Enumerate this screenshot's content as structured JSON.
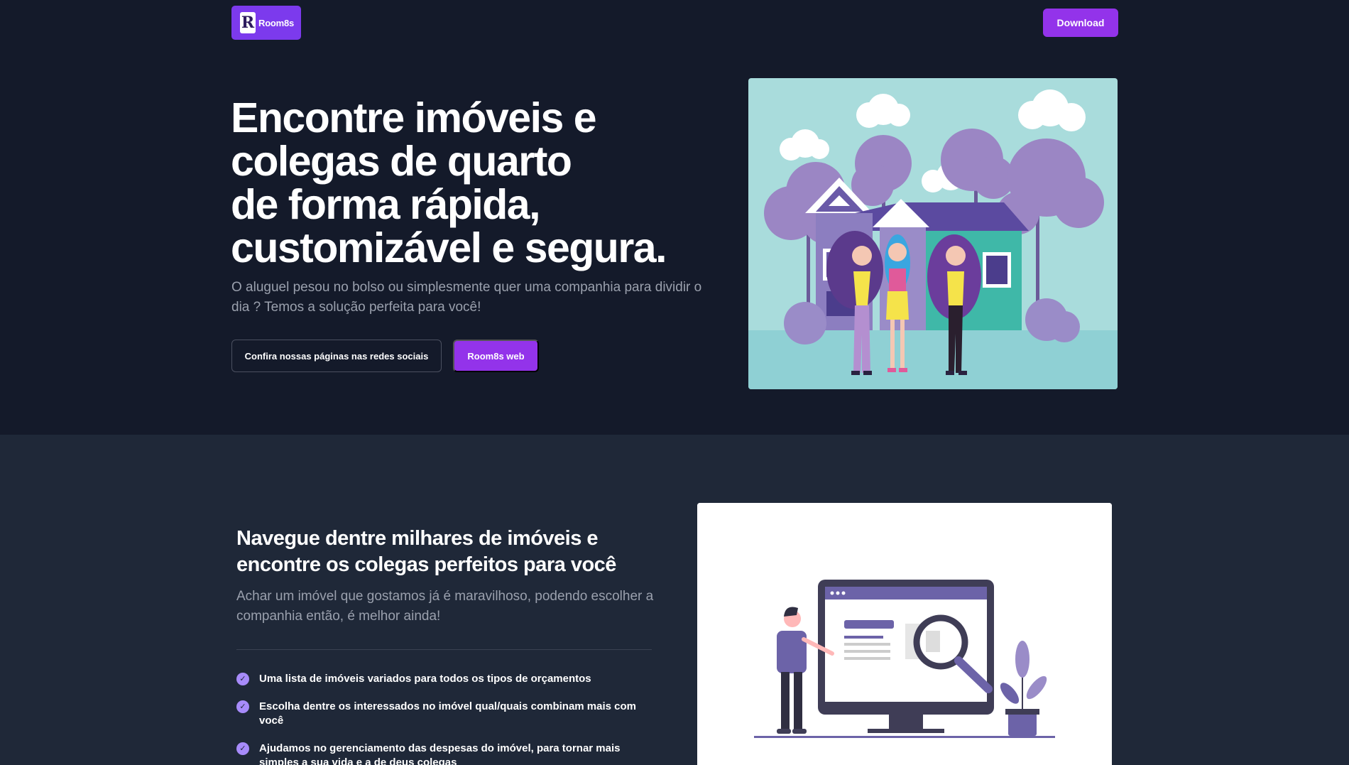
{
  "header": {
    "logo_text": "Room8s",
    "logo_mark": "R",
    "download_label": "Download"
  },
  "hero": {
    "title": "Encontre imóveis e\ncolegas de quarto\nde forma rápida,\ncustomizável e segura.",
    "subtitle": "O aluguel pesou no bolso ou simplesmente quer uma companhia para dividir o dia ? Temos a solução perfeita para você!",
    "social_button": "Confira nossas páginas nas redes sociais",
    "web_button": "Room8s web",
    "image_icon": "house-roommates-illustration"
  },
  "section2": {
    "title": "Navegue dentre milhares de imóveis e encontre os colegas perfeitos para você",
    "subtitle": "Achar um imóvel que gostamos já é maravilhoso, podendo escolher a companhia então, é melhor ainda!",
    "features": [
      "Uma lista de imóveis variados para todos os tipos de orçamentos",
      "Escolha dentre os interessados no imóvel qual/quais combinam mais com você",
      "Ajudamos no gerenciamento das despesas do imóvel, para tornar mais simples a sua vida e a de deus colegas"
    ],
    "image_icon": "search-monitor-illustration"
  },
  "colors": {
    "background": "#141a2a",
    "section_bg": "#1f2838",
    "accent": "#9333ea",
    "check": "#a78bfa"
  }
}
